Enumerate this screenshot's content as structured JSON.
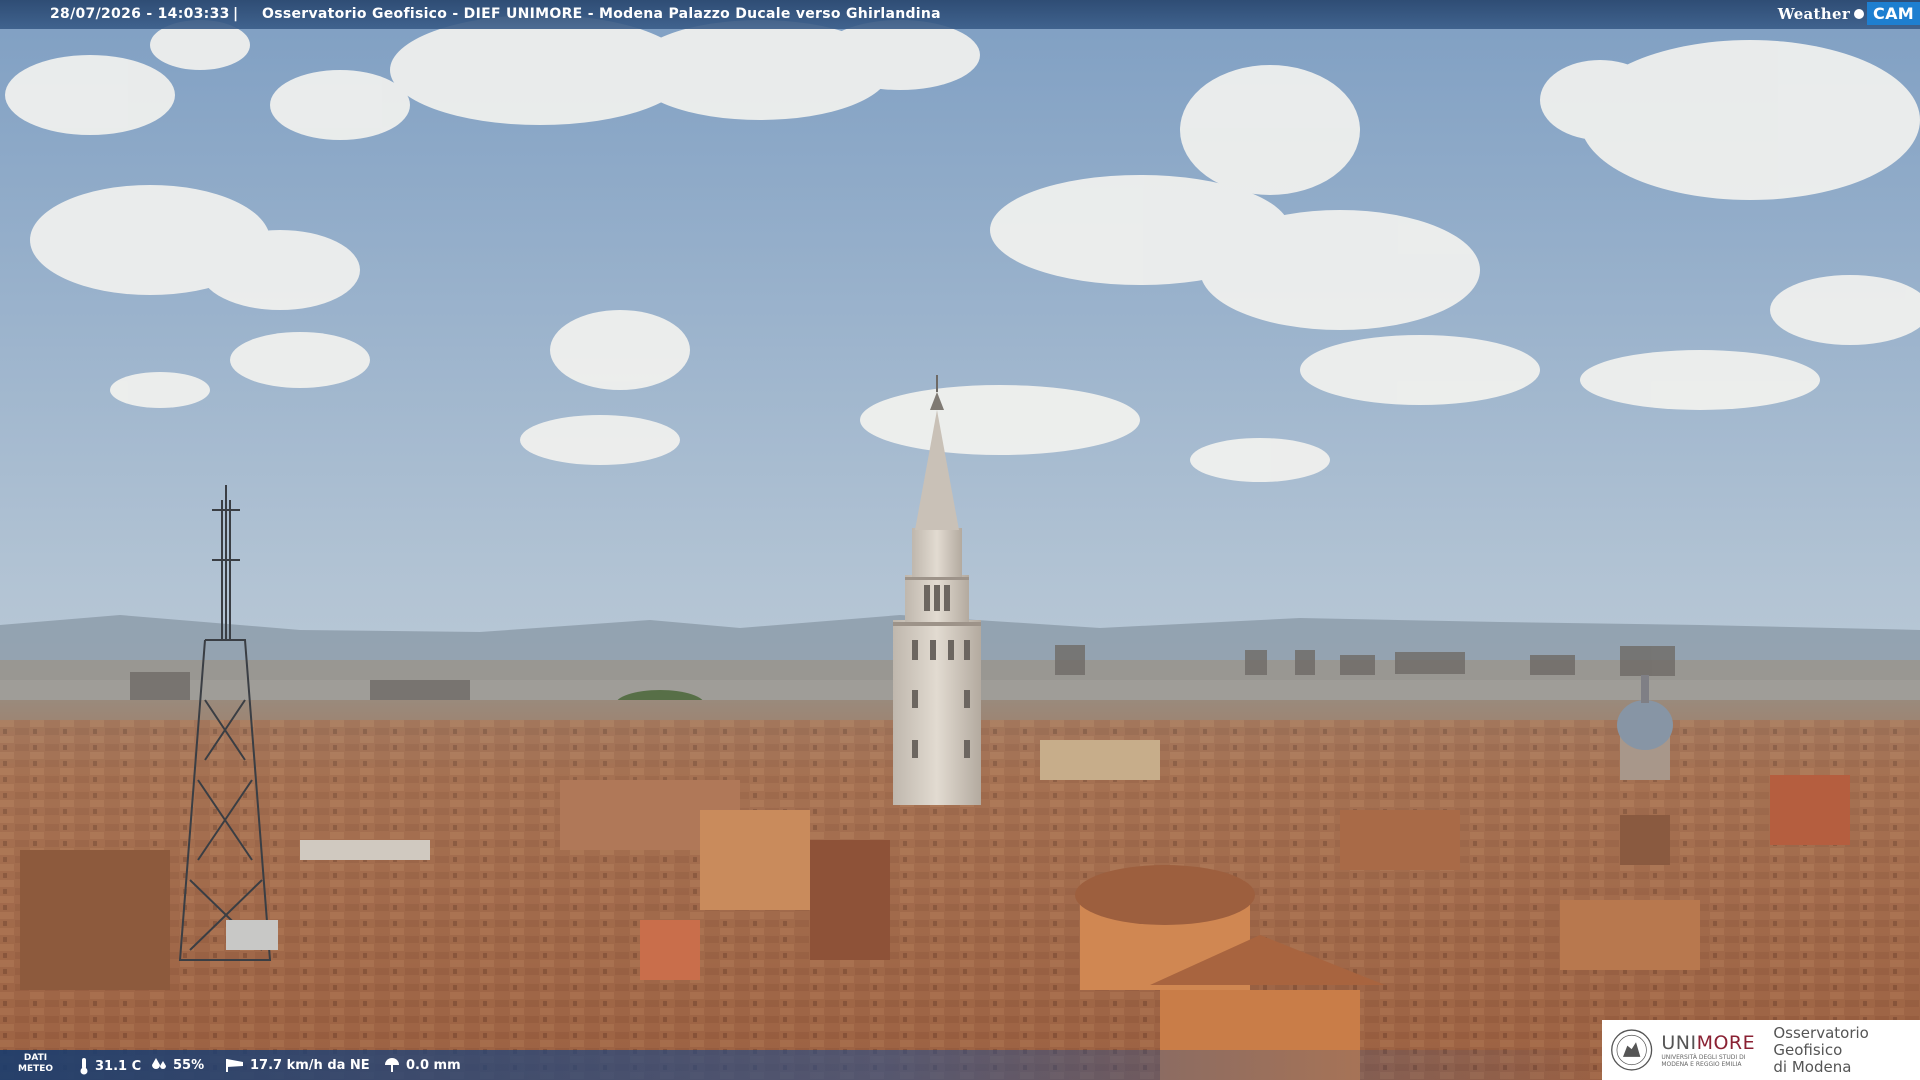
{
  "header": {
    "timestamp": "28/07/2026 - 14:03:33",
    "separator": "|",
    "title": "Osservatorio Geofisico - DIEF UNIMORE - Modena Palazzo Ducale verso Ghirlandina",
    "brand_weather": "Weather",
    "brand_cam": "CAM"
  },
  "meteo": {
    "label_line1": "DATI",
    "label_line2": "METEO",
    "temperature": "31.1 C",
    "humidity": "55%",
    "wind": "17.7 km/h da NE",
    "rain": "0.0 mm"
  },
  "logo": {
    "uni": "UNI",
    "more": "MORE",
    "sub1": "UNIVERSITÀ DEGLI STUDI DI",
    "sub2": "MODENA E REGGIO EMILIA",
    "observatory_line1": "Osservatorio Geofisico",
    "observatory_line2": "di Modena"
  },
  "icons": {
    "temperature": "thermometer-icon",
    "humidity": "droplets-icon",
    "wind": "windsock-icon",
    "rain": "rain-gauge-icon"
  },
  "colors": {
    "sky_top": "#7f9fc3",
    "sky_bottom": "#c9d6df",
    "roofs": "#a86a48",
    "tower": "#d4cdc3",
    "accent_unimore": "#8a2133"
  }
}
